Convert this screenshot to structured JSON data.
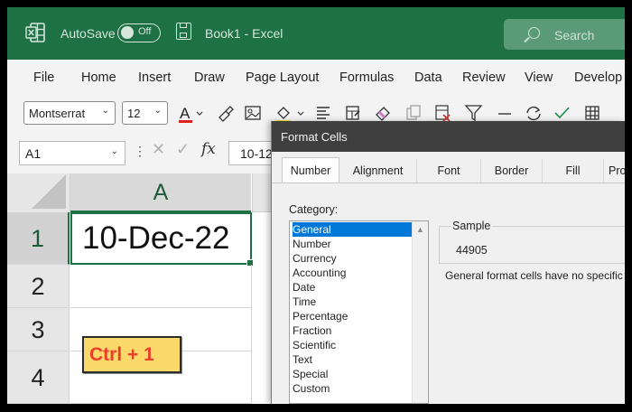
{
  "titlebar": {
    "autosave_label": "AutoSave",
    "autosave_state": "Off",
    "doc_title": "Book1 - Excel",
    "search_label": "Search",
    "color": "#1e7145"
  },
  "menu": [
    "File",
    "Home",
    "Insert",
    "Draw",
    "Page Layout",
    "Formulas",
    "Data",
    "Review",
    "View",
    "Develop"
  ],
  "toolbar": {
    "font_name": "Montserrat",
    "font_size": "12",
    "icons": [
      "font-color-icon",
      "format-painter-icon",
      "image-icon",
      "fill-color-icon",
      "align-icon",
      "format-icon",
      "eraser-icon",
      "copy-icon",
      "delete-icon",
      "filter-icon",
      "minus-icon",
      "refresh-icon",
      "check-icon",
      "grid-icon"
    ]
  },
  "formula_bar": {
    "name_box": "A1",
    "fx_label": "fx",
    "value": "10-12"
  },
  "grid": {
    "column": "A",
    "rows": [
      "1",
      "2",
      "3",
      "4"
    ],
    "a1_value": "10-Dec-22",
    "shortcut_badge": "Ctrl + 1"
  },
  "dialog": {
    "title": "Format Cells",
    "tabs": [
      "Number",
      "Alignment",
      "Font",
      "Border",
      "Fill",
      "Pro"
    ],
    "active_tab": "Number",
    "category_label": "Category:",
    "categories": [
      "General",
      "Number",
      "Currency",
      "Accounting",
      "Date",
      "Time",
      "Percentage",
      "Fraction",
      "Scientific",
      "Text",
      "Special",
      "Custom"
    ],
    "selected_category": "General",
    "sample_label": "Sample",
    "sample_value": "44905",
    "description": "General format cells have no specific n"
  }
}
